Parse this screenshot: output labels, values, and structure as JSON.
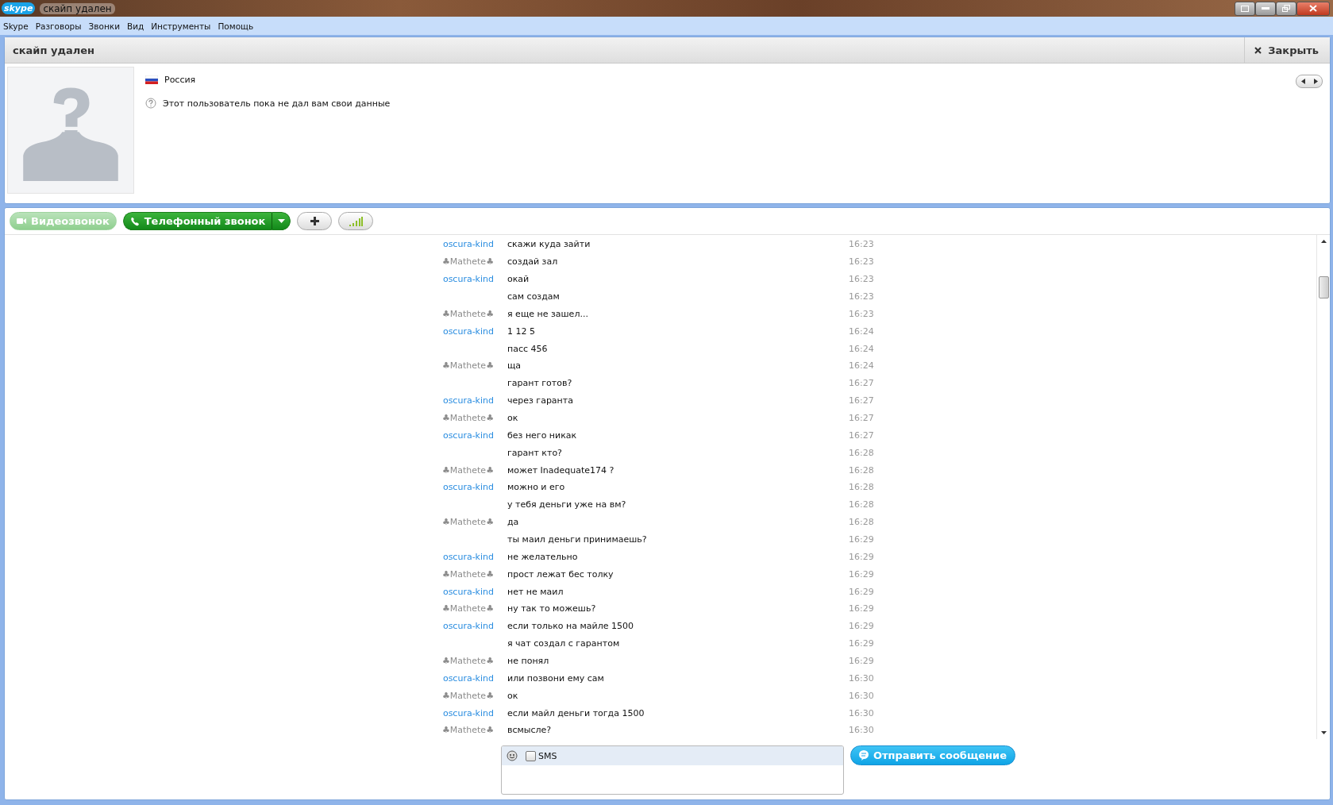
{
  "window": {
    "logo": "skype",
    "title": "скайп удален"
  },
  "menu": [
    "Skype",
    "Разговоры",
    "Звонки",
    "Вид",
    "Инструменты",
    "Помощь"
  ],
  "header": {
    "title": "скайп удален",
    "close": "Закрыть"
  },
  "profile": {
    "country": "Россия",
    "note": "Этот пользователь пока не дал вам свои данные"
  },
  "toolbar": {
    "video_call": {
      "label": "Видеозвонок",
      "disabled": true
    },
    "phone_call": {
      "label": "Телефонный звонок",
      "disabled": false
    }
  },
  "messages": [
    {
      "kind": "contact",
      "sender": "oscura-kind",
      "text": "скажи куда зайти",
      "time": "16:23"
    },
    {
      "kind": "self",
      "sender": "♣Mathete♣",
      "text": "создай зал",
      "time": "16:23"
    },
    {
      "kind": "contact",
      "sender": "oscura-kind",
      "text": "окай",
      "time": "16:23"
    },
    {
      "text": "сам создам",
      "time": "16:23"
    },
    {
      "kind": "self",
      "sender": "♣Mathete♣",
      "text": "я еще не зашел...",
      "time": "16:23"
    },
    {
      "kind": "contact",
      "sender": "oscura-kind",
      "text": "1 12 5",
      "time": "16:24"
    },
    {
      "text": "пасс 456",
      "time": "16:24"
    },
    {
      "kind": "self",
      "sender": "♣Mathete♣",
      "text": "ща",
      "time": "16:24"
    },
    {
      "text": "гарант готов?",
      "time": "16:27"
    },
    {
      "kind": "contact",
      "sender": "oscura-kind",
      "text": "через гаранта",
      "time": "16:27"
    },
    {
      "kind": "self",
      "sender": "♣Mathete♣",
      "text": "ок",
      "time": "16:27"
    },
    {
      "kind": "contact",
      "sender": "oscura-kind",
      "text": "без него никак",
      "time": "16:27"
    },
    {
      "text": "гарант кто?",
      "time": "16:28"
    },
    {
      "kind": "self",
      "sender": "♣Mathete♣",
      "text": "может Inadequate174 ?",
      "time": "16:28"
    },
    {
      "kind": "contact",
      "sender": "oscura-kind",
      "text": "можно и его",
      "time": "16:28"
    },
    {
      "text": "у тебя деньги уже на вм?",
      "time": "16:28"
    },
    {
      "kind": "self",
      "sender": "♣Mathete♣",
      "text": "да",
      "time": "16:28"
    },
    {
      "text": "ты маил деньги принимаешь?",
      "time": "16:29"
    },
    {
      "kind": "contact",
      "sender": "oscura-kind",
      "text": "не желательно",
      "time": "16:29"
    },
    {
      "kind": "self",
      "sender": "♣Mathete♣",
      "text": "прост лежат бес толку",
      "time": "16:29"
    },
    {
      "kind": "contact",
      "sender": "oscura-kind",
      "text": "нет не маил",
      "time": "16:29"
    },
    {
      "kind": "self",
      "sender": "♣Mathete♣",
      "text": "ну так то можешь?",
      "time": "16:29"
    },
    {
      "kind": "contact",
      "sender": "oscura-kind",
      "text": "если только на майле 1500",
      "time": "16:29"
    },
    {
      "text": "я чат создал с гарантом",
      "time": "16:29"
    },
    {
      "kind": "self",
      "sender": "♣Mathete♣",
      "text": "не понял",
      "time": "16:29"
    },
    {
      "kind": "contact",
      "sender": "oscura-kind",
      "text": "или позвони ему сам",
      "time": "16:30"
    },
    {
      "kind": "self",
      "sender": "♣Mathete♣",
      "text": "ок",
      "time": "16:30"
    },
    {
      "kind": "contact",
      "sender": "oscura-kind",
      "text": "если майл деньги тогда 1500",
      "time": "16:30"
    },
    {
      "kind": "self",
      "sender": "♣Mathete♣",
      "text": "всмысле?",
      "time": "16:30"
    }
  ],
  "compose": {
    "sms": {
      "label": "SMS",
      "checked": false
    },
    "send": "Отправить сообщение"
  }
}
